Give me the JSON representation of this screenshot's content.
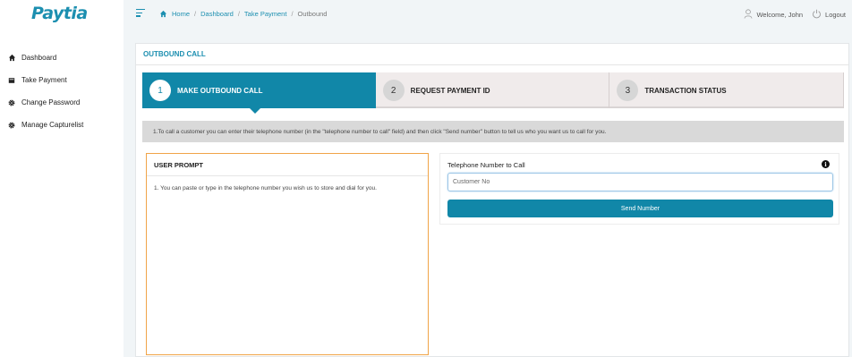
{
  "brand": {
    "logo_text": "Paytia"
  },
  "sidebar": {
    "items": [
      {
        "label": "Dashboard",
        "icon": "home-icon"
      },
      {
        "label": "Take Payment",
        "icon": "folder-icon"
      },
      {
        "label": "Change Password",
        "icon": "gear-icon"
      },
      {
        "label": "Manage Capturelist",
        "icon": "gear-icon"
      }
    ]
  },
  "breadcrumb": {
    "items": [
      "Home",
      "Dashboard",
      "Take Payment"
    ],
    "current": "Outbound"
  },
  "user": {
    "welcome": "Welcome, John",
    "logout": "Logout"
  },
  "card": {
    "title": "OUTBOUND CALL"
  },
  "steps": [
    {
      "num": "1",
      "label": "MAKE OUTBOUND CALL",
      "active": true
    },
    {
      "num": "2",
      "label": "REQUEST PAYMENT ID",
      "active": false
    },
    {
      "num": "3",
      "label": "TRANSACTION STATUS",
      "active": false
    }
  ],
  "info_bar": {
    "text": "1.To call a customer you can enter their telephone number (in the \"telephone number to call\" field) and then click \"Send number\" button to tell us who you want us to call for you."
  },
  "prompt": {
    "title": "USER PROMPT",
    "body": "1. You can paste or type in the telephone number you wish us to store and dial for you."
  },
  "phone_form": {
    "label": "Telephone Number to Call",
    "input_value": "",
    "input_placeholder": "Customer No",
    "send_label": "Send Number"
  },
  "colors": {
    "accent": "#1187a8",
    "brand": "#1c8fb0",
    "prompt_border": "#f0a448"
  }
}
